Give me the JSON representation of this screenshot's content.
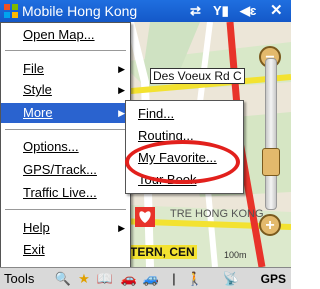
{
  "window": {
    "title": "Mobile Hong Kong"
  },
  "main_menu": {
    "items": [
      {
        "label": "Open Map...",
        "submenu": false,
        "selected": false
      },
      {
        "label": "File",
        "submenu": true,
        "selected": false
      },
      {
        "label": "Style",
        "submenu": true,
        "selected": false
      },
      {
        "label": "More",
        "submenu": true,
        "selected": true
      },
      {
        "label": "Options...",
        "submenu": false,
        "selected": false
      },
      {
        "label": "GPS/Track...",
        "submenu": false,
        "selected": false
      },
      {
        "label": "Traffic Live...",
        "submenu": false,
        "selected": false
      },
      {
        "label": "Help",
        "submenu": true,
        "selected": false
      },
      {
        "label": "Exit",
        "submenu": false,
        "selected": false
      }
    ]
  },
  "more_submenu": {
    "items": [
      {
        "label": "Find..."
      },
      {
        "label": "Routing..."
      },
      {
        "label": "My Favorite..."
      },
      {
        "label": "Tour Book"
      }
    ],
    "highlighted": "My Favorite..."
  },
  "map": {
    "road_label_1": "Des Voeux Rd C",
    "road_label_2": "TRE HONG KONG",
    "road_label_3": "TERN, CEN",
    "scale_label": "100m"
  },
  "toolbar": {
    "tools_label": "Tools",
    "gps_label": "GPS"
  },
  "colors": {
    "titlebar": "#1458c8",
    "menu_selection": "#2a63cf",
    "annotation": "#e2201c",
    "route": "#e8332a"
  },
  "icons": [
    "windows-flag-icon",
    "sync-icon",
    "signal-icon",
    "volume-icon",
    "close-icon",
    "search-icon",
    "favorite-star-icon",
    "tourbook-icon",
    "car-icon",
    "pedestrian-icon",
    "gps-icon",
    "zoom-in-icon",
    "zoom-out-icon"
  ]
}
